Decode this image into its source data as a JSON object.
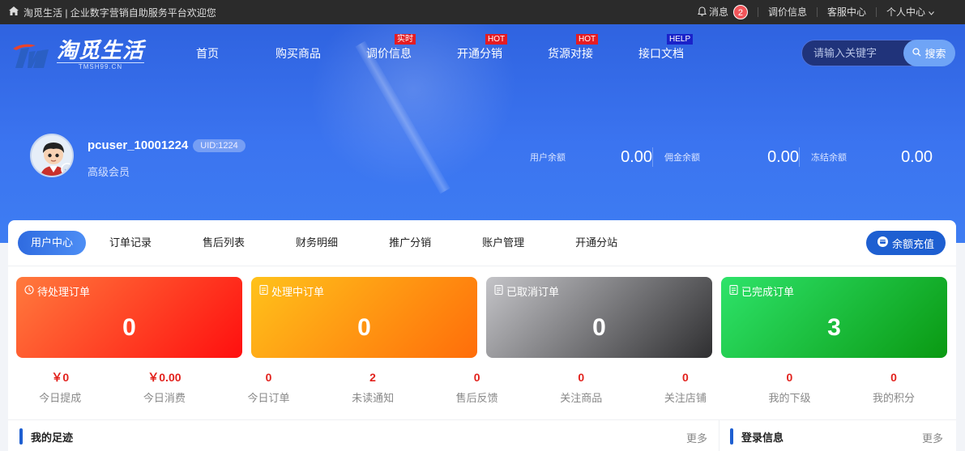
{
  "topbar": {
    "welcome": "淘觅生活 | 企业数字营销自助服务平台欢迎您",
    "message_label": "消息",
    "message_count": "2",
    "links": [
      "调价信息",
      "客服中心",
      "个人中心"
    ]
  },
  "logo": {
    "cn": "淘觅生活",
    "en": "TMSH99.CN"
  },
  "nav": [
    {
      "label": "首页",
      "tag": ""
    },
    {
      "label": "购买商品",
      "tag": ""
    },
    {
      "label": "调价信息",
      "tag": "实时"
    },
    {
      "label": "开通分销",
      "tag": "HOT"
    },
    {
      "label": "货源对接",
      "tag": "HOT"
    },
    {
      "label": "接口文档",
      "tag": "HELP"
    }
  ],
  "search": {
    "placeholder": "请输入关键字",
    "button": "搜索"
  },
  "profile": {
    "username": "pcuser_10001224",
    "uid": "UID:1224",
    "level": "高级会员"
  },
  "balances": [
    {
      "label": "用户余额",
      "value": "0.00"
    },
    {
      "label": "佣金余额",
      "value": "0.00"
    },
    {
      "label": "冻结余额",
      "value": "0.00"
    }
  ],
  "tabs": [
    "用户中心",
    "订单记录",
    "售后列表",
    "财务明细",
    "推广分销",
    "账户管理",
    "开通分站"
  ],
  "recharge_label": "余额充值",
  "order_cards": [
    {
      "title": "待处理订单",
      "value": "0"
    },
    {
      "title": "处理中订单",
      "value": "0"
    },
    {
      "title": "已取消订单",
      "value": "0"
    },
    {
      "title": "已完成订单",
      "value": "3"
    }
  ],
  "stats": [
    {
      "value": "￥0",
      "label": "今日提成"
    },
    {
      "value": "￥0.00",
      "label": "今日消费"
    },
    {
      "value": "0",
      "label": "今日订单"
    },
    {
      "value": "2",
      "label": "未读通知"
    },
    {
      "value": "0",
      "label": "售后反馈"
    },
    {
      "value": "0",
      "label": "关注商品"
    },
    {
      "value": "0",
      "label": "关注店铺"
    },
    {
      "value": "0",
      "label": "我的下级"
    },
    {
      "value": "0",
      "label": "我的积分"
    }
  ],
  "sections": {
    "footprint": {
      "title": "我的足迹",
      "more": "更多"
    },
    "login": {
      "title": "登录信息",
      "more": "更多"
    }
  },
  "colors": {
    "primary": "#1e5fd1",
    "topbar": "#2b2b2b",
    "accent_red": "#e2211c"
  }
}
